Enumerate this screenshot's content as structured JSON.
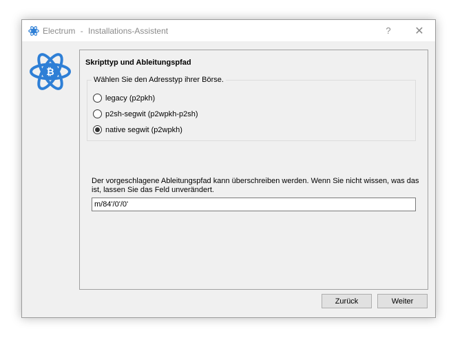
{
  "window": {
    "app_name": "Electrum",
    "separator": "-",
    "title": "Installations-Assistent",
    "help_label": "?",
    "close_label": "✕"
  },
  "page": {
    "heading": "Skripttyp und Ableitungspfad",
    "group_title": "Wählen Sie den Adresstyp ihrer Börse.",
    "options": [
      {
        "label": "legacy (p2pkh)",
        "selected": false
      },
      {
        "label": "p2sh-segwit (p2wpkh-p2sh)",
        "selected": false
      },
      {
        "label": "native segwit (p2wpkh)",
        "selected": true
      }
    ],
    "hint": "Der vorgeschlagene Ableitungspfad kann überschreiben werden. Wenn Sie nicht wissen, was das ist, lassen Sie das Feld unverändert.",
    "path_value": "m/84'/0'/0'"
  },
  "buttons": {
    "back": "Zurück",
    "next": "Weiter"
  },
  "colors": {
    "brand_blue": "#2e7fd6",
    "window_bg": "#f0f0f0"
  },
  "icons": {
    "app": "electrum-icon",
    "logo": "electrum-logo"
  }
}
